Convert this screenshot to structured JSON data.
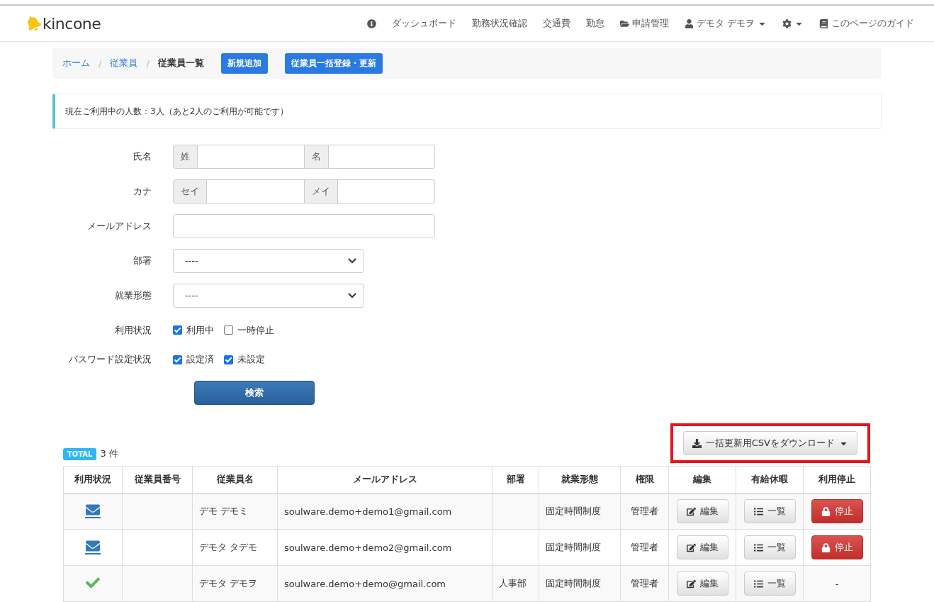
{
  "brand": {
    "name": "kincone"
  },
  "nav": [
    {
      "kind": "info"
    },
    {
      "kind": "text",
      "label": "ダッシュボード"
    },
    {
      "kind": "text",
      "label": "勤務状況確認"
    },
    {
      "kind": "text",
      "label": "交通費"
    },
    {
      "kind": "text",
      "label": "勤怠"
    },
    {
      "kind": "folder",
      "label": "申請管理"
    },
    {
      "kind": "user",
      "label": "デモタ デモヲ"
    },
    {
      "kind": "gear"
    },
    {
      "kind": "book",
      "label": "このページのガイド"
    }
  ],
  "breadcrumb": [
    {
      "label": "ホーム",
      "current": false
    },
    {
      "label": "従業員",
      "current": false
    },
    {
      "label": "従業員一覧",
      "current": true
    }
  ],
  "breadcrumb_separator": "/",
  "header_buttons": [
    "新規追加",
    "従業員一括登録・更新"
  ],
  "notice": "現在ご利用中の人数：3人（あと2人のご利用が可能です）",
  "form": [
    {
      "kind": "pair",
      "label": "氏名",
      "addons": [
        "姓",
        "名"
      ]
    },
    {
      "kind": "pair",
      "label": "カナ",
      "addons": [
        "セイ",
        "メイ"
      ]
    },
    {
      "kind": "input",
      "label": "メールアドレス"
    },
    {
      "kind": "select",
      "label": "部署",
      "value": "----"
    },
    {
      "kind": "select",
      "label": "就業形態",
      "value": "----"
    },
    {
      "kind": "checks",
      "label": "利用状況",
      "options": [
        {
          "label": "利用中",
          "checked": true
        },
        {
          "label": "一時停止",
          "checked": false
        }
      ]
    },
    {
      "kind": "checks",
      "label": "パスワード設定状況",
      "options": [
        {
          "label": "設定済",
          "checked": true
        },
        {
          "label": "未設定",
          "checked": true
        }
      ]
    }
  ],
  "search_button": "検索",
  "total": {
    "badge": "TOTAL",
    "count": "3 件"
  },
  "download_button": {
    "label": "一括更新用CSVをダウンロード",
    "highlighted": true
  },
  "table": {
    "columns": [
      "利用状況",
      "従業員番号",
      "従業員名",
      "メールアドレス",
      "部署",
      "就業形態",
      "権限",
      "編集",
      "有給休暇",
      "利用停止"
    ],
    "rows": [
      {
        "kind": "invited",
        "name": "デモ デモミ",
        "email": "soulware.demo+demo1@gmail.com",
        "work_type": "固定時間制度",
        "role": "管理者",
        "edit": "編集",
        "leave": "一覧",
        "stop": {
          "kind": "button",
          "label": "停止"
        }
      },
      {
        "kind": "invited",
        "name": "デモタ タデモ",
        "email": "soulware.demo+demo2@gmail.com",
        "work_type": "固定時間制度",
        "role": "管理者",
        "edit": "編集",
        "leave": "一覧",
        "stop": {
          "kind": "button",
          "label": "停止"
        }
      },
      {
        "kind": "active",
        "name": "デモタ デモヲ",
        "email": "soulware.demo+demo@gmail.com",
        "department": "人事部",
        "work_type": "固定時間制度",
        "role": "管理者",
        "edit": "編集",
        "leave": "一覧",
        "stop": {
          "kind": "text",
          "label": "-"
        }
      }
    ]
  }
}
